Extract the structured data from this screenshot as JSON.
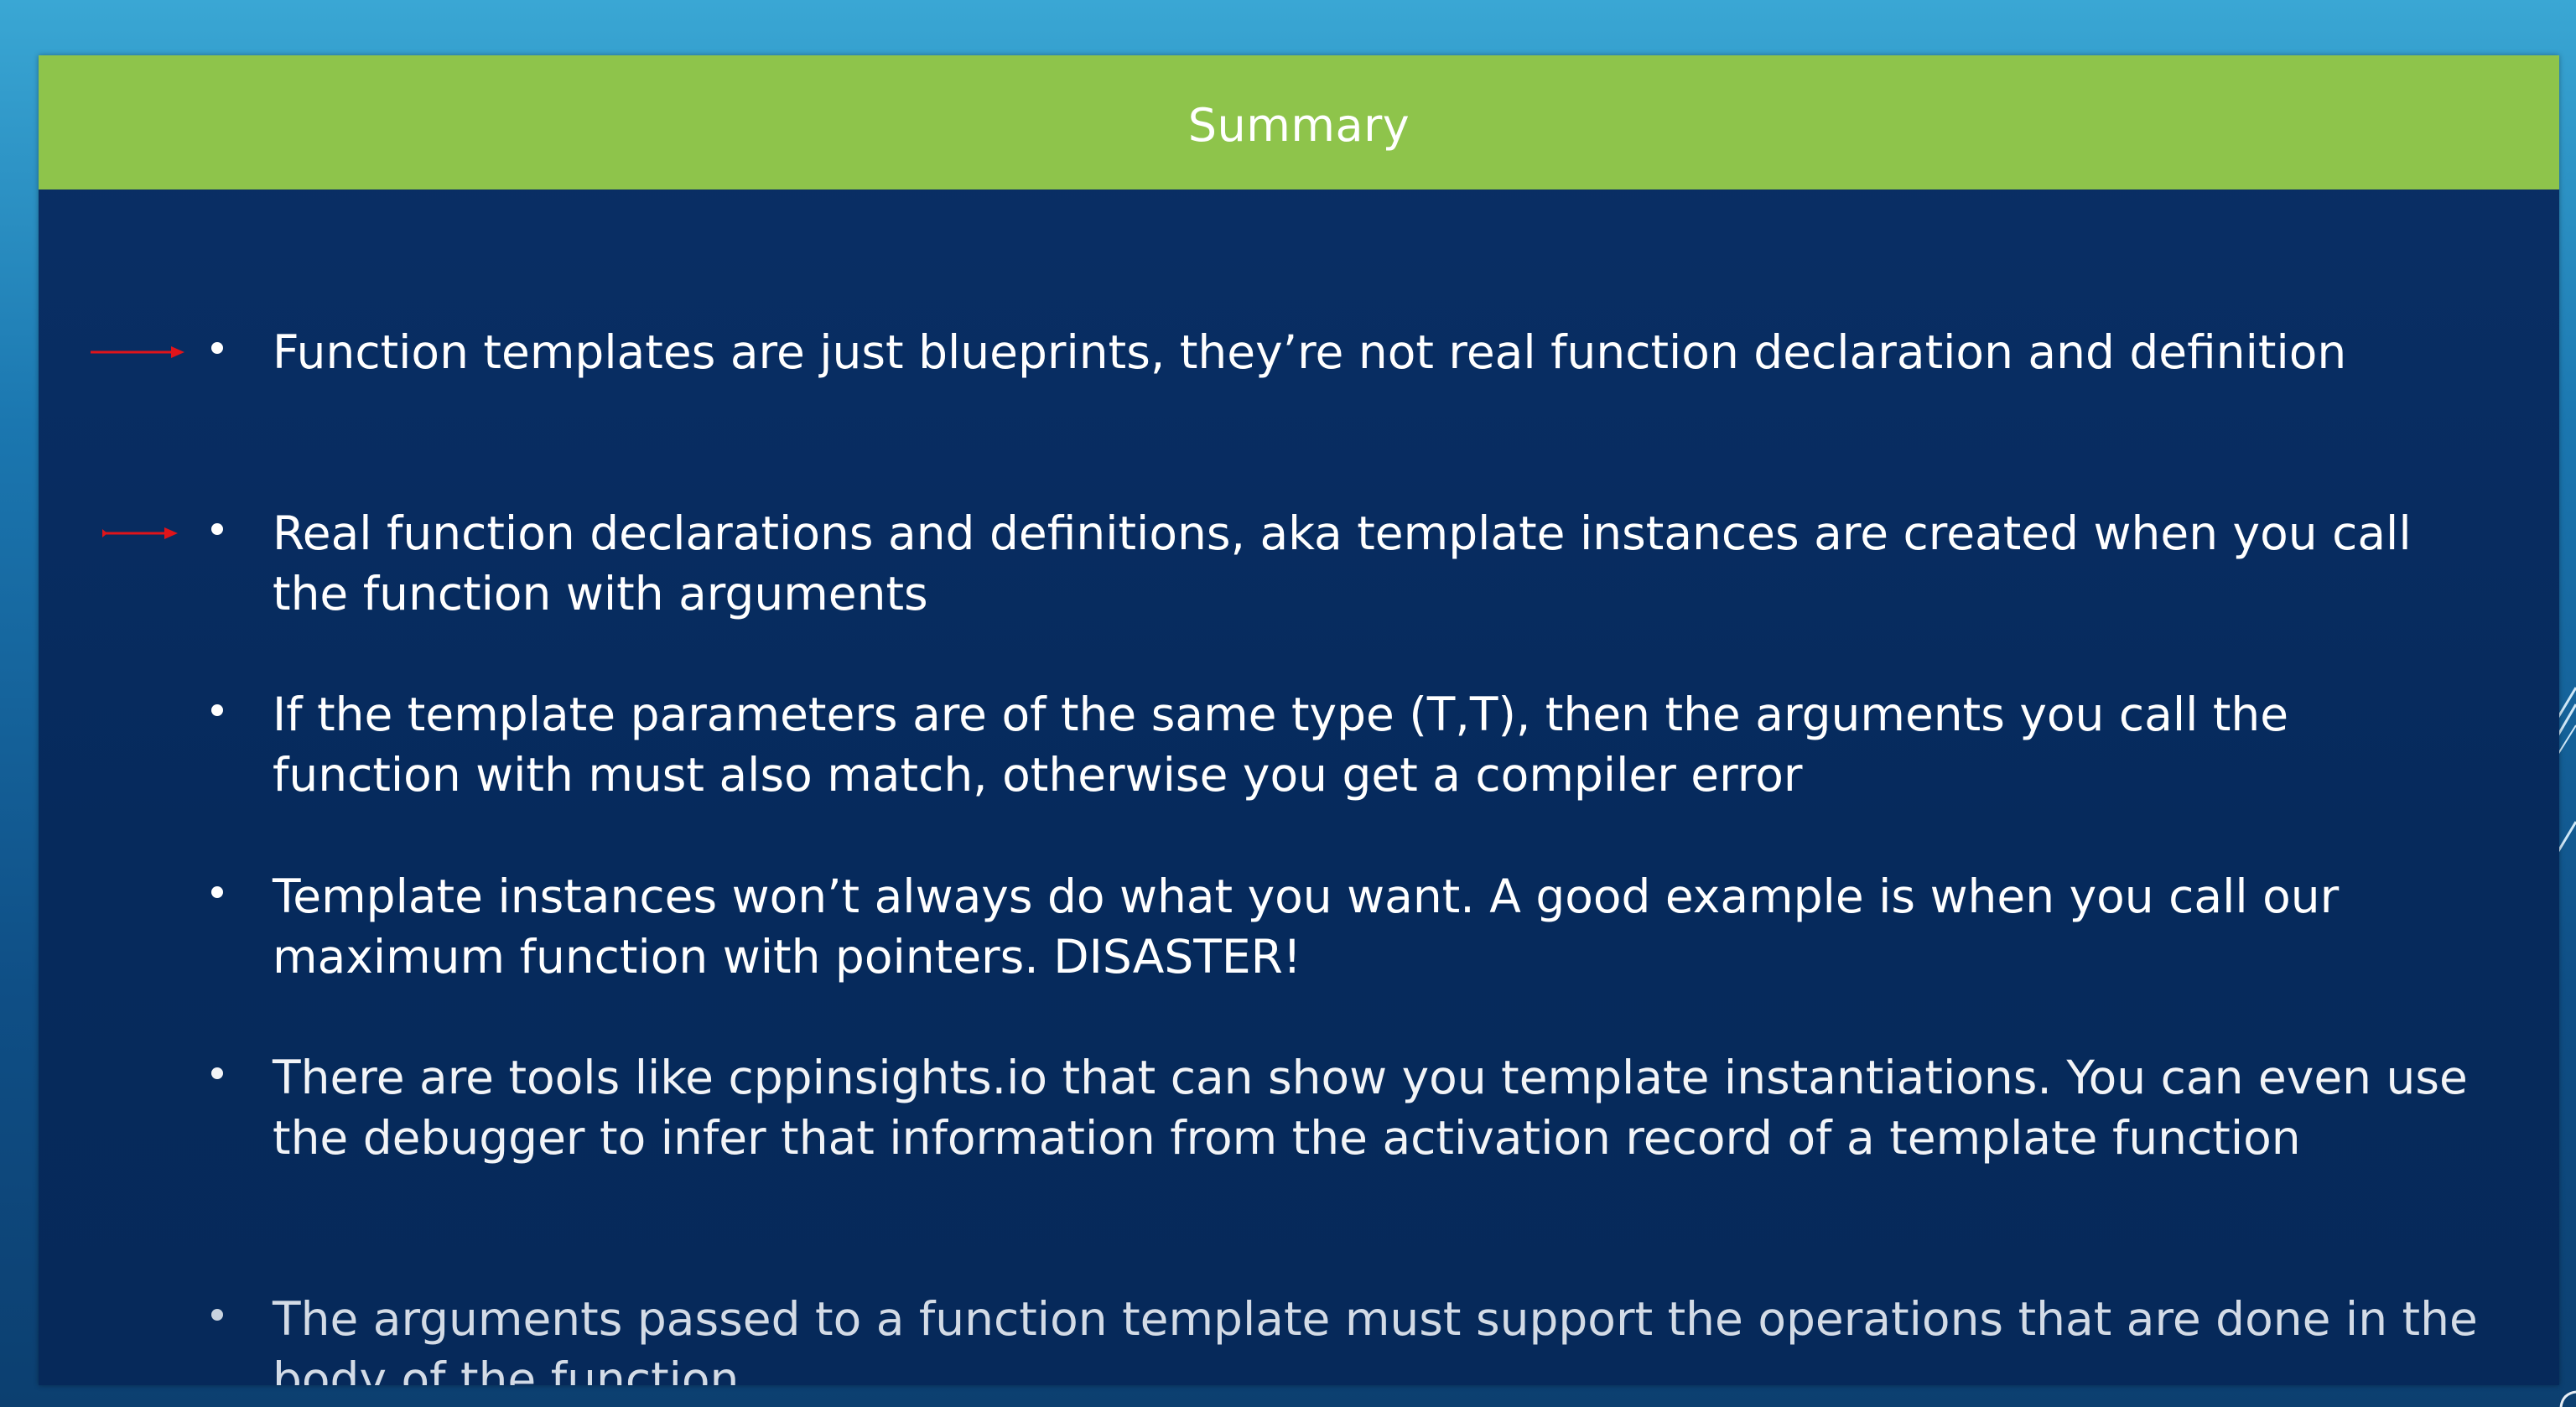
{
  "slide": {
    "title": "Summary",
    "bullets": [
      {
        "text": "Function templates are just blueprints, they’re not real function declaration and definition",
        "annotated": true
      },
      {
        "text": "Real function declarations and definitions, aka template instances are created when you call the function with arguments",
        "annotated": true
      },
      {
        "text": "If the template parameters are of the same type (T,T), then the arguments you call the function with must also match, otherwise you get a compiler error",
        "annotated": false
      },
      {
        "text": "Template instances won’t always do what you want. A good example is when you call our maximum function with pointers. DISASTER!",
        "annotated": false
      },
      {
        "text": "There are tools like cppinsights.io that can show you template instantiations. You can even use the debugger to infer that information from the activation record of a template function",
        "annotated": false
      },
      {
        "text": "The arguments passed to a function template must support the operations that are done in the body of the function",
        "annotated": false
      }
    ]
  },
  "colors": {
    "title_bar": "#8ec44b",
    "slide_bg": "#062a5c",
    "text": "#ffffff",
    "annotation_arrow": "#e0141a"
  },
  "icons": {
    "annotation": "arrow-right-icon"
  }
}
